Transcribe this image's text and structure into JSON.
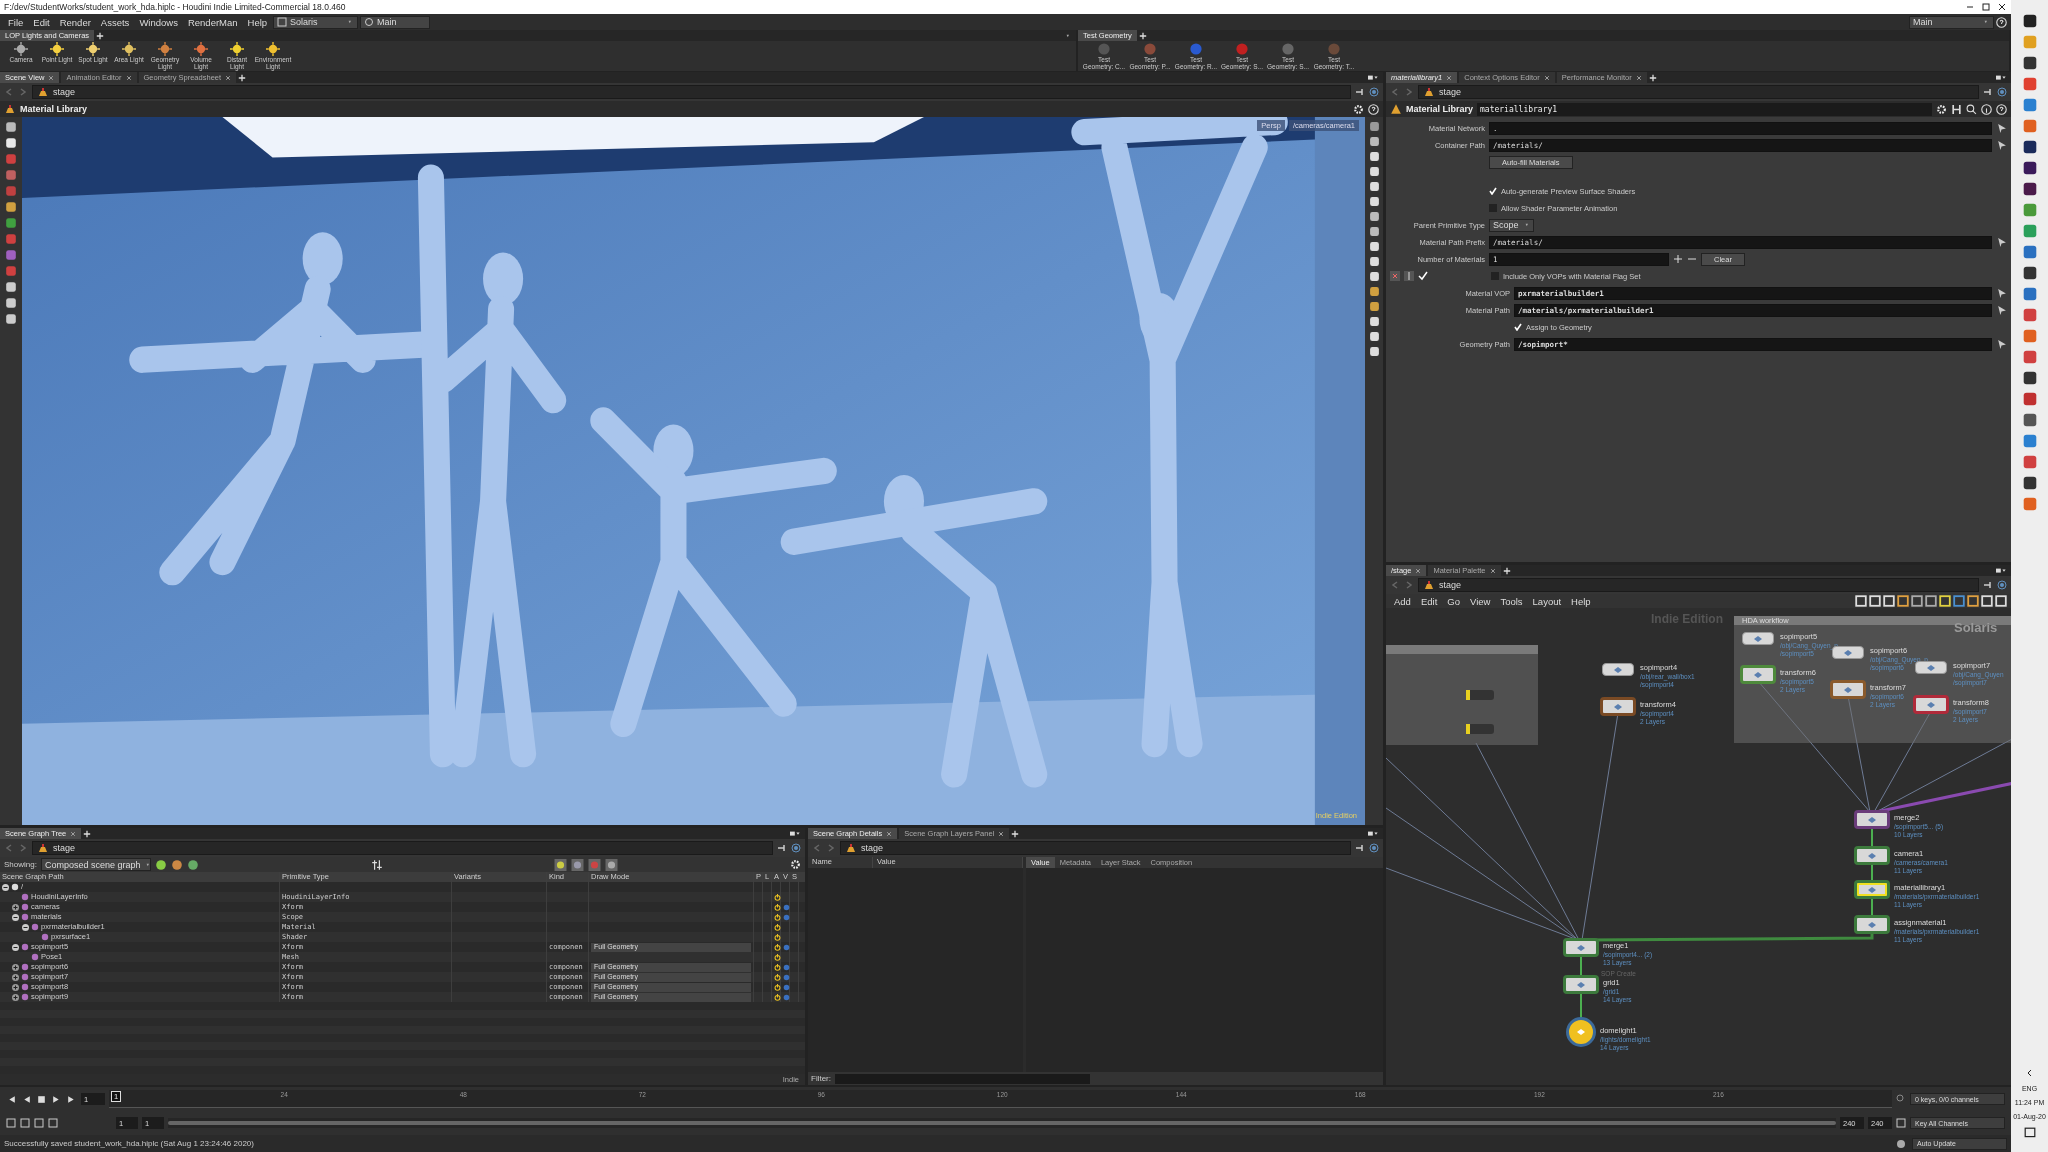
{
  "window": {
    "title": "F:/dev/StudentWorks/student_work_hda.hiplc - Houdini Indie Limited-Commercial 18.0.460"
  },
  "menu": [
    "File",
    "Edit",
    "Render",
    "Assets",
    "Windows",
    "RenderMan",
    "Help"
  ],
  "desktop": "Solaris",
  "context": "Main",
  "desk_right": "Main",
  "shelves": [
    {
      "tab": "LOP Lights and Cameras",
      "tools": [
        "Camera",
        "Point Light",
        "Spot Light",
        "Area Light",
        "Geometry Light",
        "Volume Light",
        "Distant Light",
        "Environment Light"
      ]
    },
    {
      "tab": "Test Geometry",
      "tools": [
        "Test Geometry: C...",
        "Test Geometry: P...",
        "Test Geometry: R...",
        "Test Geometry: S...",
        "Test Geometry: S...",
        "Test Geometry: T..."
      ]
    }
  ],
  "viewer": {
    "tabs": [
      {
        "label": "Scene View",
        "selected": true
      },
      {
        "label": "Animation Editor",
        "selected": false
      },
      {
        "label": "Geometry Spreadsheet",
        "selected": false
      }
    ],
    "path": "stage",
    "header": "Material Library",
    "view_menu": "Persp",
    "camera": "/cameras/camera1",
    "watermark": "Indie Edition"
  },
  "scene_graph_tree": {
    "tabs": [
      {
        "label": "Scene Graph Tree",
        "selected": true
      }
    ],
    "path": "stage",
    "showing_label": "Showing:",
    "showing": "Composed scene graph",
    "columns": [
      "Scene Graph Path",
      "Primitive Type",
      "Variants",
      "Kind",
      "Draw Mode",
      "P",
      "L",
      "A",
      "V",
      "S"
    ],
    "rows": [
      {
        "name": "/",
        "type": "",
        "expanded": true,
        "children": [
          {
            "name": "HoudiniLayerInfo",
            "type": "HoudiniLayerInfo"
          },
          {
            "name": "cameras",
            "type": "Xform",
            "expanded": false
          },
          {
            "name": "materials",
            "type": "Scope",
            "expanded": true,
            "children": [
              {
                "name": "pxrmaterialbuilder1",
                "type": "Material",
                "expanded": true,
                "children": [
                  {
                    "name": "pxrsurface1",
                    "type": "Shader"
                  }
                ]
              }
            ]
          },
          {
            "name": "sopimport5",
            "type": "Xform",
            "kind": "componen",
            "draw_mode": "Full Geometry",
            "expanded": true,
            "children": [
              {
                "name": "Pose1",
                "type": "Mesh"
              }
            ]
          },
          {
            "name": "sopimport6",
            "type": "Xform",
            "kind": "componen",
            "draw_mode": "Full Geometry",
            "expanded": false
          },
          {
            "name": "sopimport7",
            "type": "Xform",
            "kind": "componen",
            "draw_mode": "Full Geometry",
            "expanded": false
          },
          {
            "name": "sopimport8",
            "type": "Xform",
            "kind": "componen",
            "draw_mode": "Full Geometry",
            "expanded": false
          },
          {
            "name": "sopimport9",
            "type": "Xform",
            "kind": "componen",
            "draw_mode": "Full Geometry",
            "expanded": false
          }
        ]
      }
    ],
    "footer": "Indie"
  },
  "details": {
    "tabs": [
      {
        "label": "Scene Graph Details",
        "selected": true
      },
      {
        "label": "Scene Graph Layers Panel",
        "selected": false
      }
    ],
    "path": "stage",
    "columns": [
      "Name",
      "Value"
    ],
    "side_tabs": [
      {
        "label": "Value",
        "selected": true
      },
      {
        "label": "Metadata",
        "selected": false
      },
      {
        "label": "Layer Stack",
        "selected": false
      },
      {
        "label": "Composition",
        "selected": false
      }
    ],
    "filter_label": "Filter:"
  },
  "params": {
    "tabs": [
      {
        "label": "materiallibrary1",
        "selected": true
      },
      {
        "label": "Context Options Editor",
        "selected": false
      },
      {
        "label": "Performance Monitor",
        "selected": false
      }
    ],
    "path": "stage",
    "node_type": "Material Library",
    "node_name": "materiallibrary1",
    "rows": [
      {
        "kind": "field",
        "label": "Material Network",
        "value": "."
      },
      {
        "kind": "field",
        "label": "Container Path",
        "value": "/materials/"
      },
      {
        "kind": "button",
        "label": "Auto-fill Materials"
      },
      {
        "kind": "check",
        "label": "Auto-generate Preview Surface Shaders",
        "checked": true
      },
      {
        "kind": "check",
        "label": "Allow Shader Parameter Animation",
        "checked": false
      },
      {
        "kind": "menu",
        "label": "Parent Primitive Type",
        "value": "Scope"
      },
      {
        "kind": "field",
        "label": "Material Path Prefix",
        "value": "/materials/"
      },
      {
        "kind": "number",
        "label": "Number of Materials",
        "value": "1",
        "button": "Clear"
      },
      {
        "kind": "instance",
        "label": "Include Only VOPs with Material Flag Set",
        "checked": false
      },
      {
        "kind": "strong",
        "label": "Material VOP",
        "value": "pxrmaterialbuilder1"
      },
      {
        "kind": "strong",
        "label": "Material Path",
        "value": "/materials/pxrmaterialbuilder1"
      },
      {
        "kind": "subcheck",
        "label": "Assign to Geometry",
        "checked": true
      },
      {
        "kind": "strong",
        "label": "Geometry Path",
        "value": "/sopimport*"
      }
    ]
  },
  "network": {
    "tabs": [
      {
        "label": "/stage",
        "selected": true
      },
      {
        "label": "Material Palette",
        "selected": false
      }
    ],
    "path": "stage",
    "menu": [
      "Add",
      "Edit",
      "Go",
      "View",
      "Tools",
      "Layout",
      "Help"
    ],
    "watermark": "Indie Edition",
    "context_label": "Solaris",
    "box_title": "HDA workflow",
    "nodes": [
      {
        "name": "sopimport5",
        "info": [
          "/obj/Cang_Quyen_p",
          "/sopimport5"
        ],
        "selected": false
      },
      {
        "name": "transform6",
        "info": [
          "/sopimport5",
          "2 Layers"
        ],
        "color": "#4e8a3c",
        "selected": false
      },
      {
        "name": "sopimport6",
        "info": [
          "/obj/Cang_Quyen_p",
          "/sopimport6"
        ],
        "selected": false
      },
      {
        "name": "transform7",
        "info": [
          "/sopimport6",
          "2 Layers"
        ],
        "color": "#8a5a2c",
        "selected": false
      },
      {
        "name": "sopimport7",
        "info": [
          "/obj/Cang_Quyen",
          "/sopimport7"
        ],
        "selected": false
      },
      {
        "name": "transform8",
        "info": [
          "/sopimport7",
          "2 Layers"
        ],
        "color": "#b02a3a",
        "selected": false
      },
      {
        "name": "sopimport4",
        "info": [
          "/obj/rear_wall/box1",
          "/sopimport4"
        ],
        "selected": false
      },
      {
        "name": "transform4",
        "info": [
          "/sopimport4",
          "2 Layers"
        ],
        "color": "#7a4a24",
        "selected": false
      },
      {
        "name": "merge2",
        "info": [
          "/sopimport5... (5)",
          "10 Layers"
        ],
        "color": "#6a3c7a",
        "selected": false
      },
      {
        "name": "camera1",
        "info": [
          "/cameras/camera1",
          "11 Layers"
        ],
        "color": "#3c7a3c",
        "selected": false
      },
      {
        "name": "materiallibrary1",
        "info": [
          "/materials/pxrmaterialbuilder1",
          "11 Layers"
        ],
        "color": "#3c7a3c",
        "selected": true
      },
      {
        "name": "assignmaterial1",
        "info": [
          "/materials/pxrmaterialbuilder1",
          "11 Layers"
        ],
        "color": "#3c7a3c",
        "selected": false
      },
      {
        "name": "merge1",
        "info": [
          "/sopimport4... (2)",
          "13 Layers"
        ],
        "color": "#3c7a3c",
        "selected": false
      },
      {
        "name": "grid1",
        "note": "SOP Create",
        "info": [
          "/grid1",
          "14 Layers"
        ],
        "color": "#3c7a3c",
        "selected": false
      },
      {
        "name": "domelight1",
        "info": [
          "/lights/domelight1",
          "14 Layers"
        ],
        "color": "#3c6a9a",
        "selected": false
      }
    ]
  },
  "timeline": {
    "range": {
      "level": 1
    },
    "frame": "1",
    "current": "1",
    "ticks": [
      "24",
      "48",
      "72",
      "96",
      "120",
      "144",
      "168",
      "192",
      "216"
    ],
    "range_start": [
      "1",
      "1"
    ],
    "range_end": [
      "240",
      "240"
    ],
    "keys": "0 keys, 0/0 channels",
    "key_menu": "Key All Channels",
    "update": "Auto Update"
  },
  "status": "Successfully saved student_work_hda.hiplc (Sat Aug  1 23:24:46 2020)",
  "taskbar": {
    "language": "ENG",
    "time": "11:24 PM",
    "date": "01-Aug-20"
  }
}
